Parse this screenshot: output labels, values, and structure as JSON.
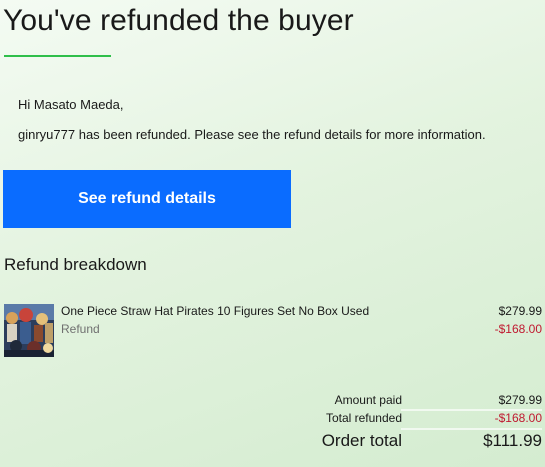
{
  "email": {
    "headline": "You've refunded the buyer",
    "greeting": "Hi Masato Maeda,",
    "message": "ginryu777 has been refunded. Please see the refund details for more information.",
    "cta_label": "See refund details"
  },
  "breakdown": {
    "title": "Refund breakdown",
    "item": {
      "title": "One Piece Straw Hat Pirates 10 Figures Set No Box Used",
      "subtitle": "Refund",
      "price": "$279.99",
      "refund": "-$168.00",
      "thumbnail_icon": "product-photo"
    },
    "summary": {
      "amount_paid_label": "Amount paid",
      "amount_paid_value": "$279.99",
      "total_refunded_label": "Total refunded",
      "total_refunded_value": "-$168.00",
      "order_total_label": "Order total",
      "order_total_value": "$111.99"
    }
  },
  "colors": {
    "accent_rule": "#2fbf4a",
    "button": "#0a6cff",
    "negative": "#c01930"
  }
}
